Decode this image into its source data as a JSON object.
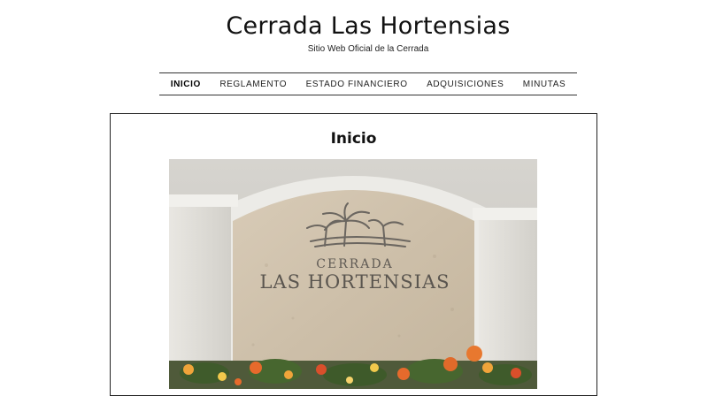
{
  "site": {
    "title": "Cerrada Las Hortensias",
    "tagline": "Sitio Web Oficial de la Cerrada"
  },
  "nav": {
    "items": [
      {
        "label": "INICIO",
        "active": true
      },
      {
        "label": "REGLAMENTO",
        "active": false
      },
      {
        "label": "ESTADO FINANCIERO",
        "active": false
      },
      {
        "label": "ADQUISICIONES",
        "active": false
      },
      {
        "label": "MINUTAS",
        "active": false
      }
    ]
  },
  "main": {
    "page_title": "Inicio",
    "hero": {
      "sign_line1": "CERRADA",
      "sign_line2": "LAS HORTENSIAS"
    }
  },
  "colors": {
    "text": "#111111",
    "border": "#333333",
    "background": "#ffffff"
  }
}
